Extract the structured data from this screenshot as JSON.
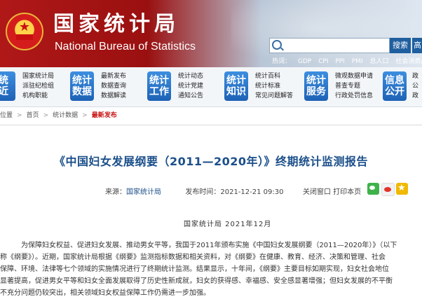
{
  "header": {
    "brand_cn": "国家统计局",
    "brand_en": "National Bureau of Statistics",
    "search": {
      "placeholder": "",
      "button_label": "搜索",
      "extra_label": "高"
    },
    "hot_links": [
      "热词：",
      "GDP",
      "CPI",
      "PPI",
      "PMI",
      "总人口",
      "社会消费品零售"
    ]
  },
  "nav": [
    {
      "tile": [
        "统",
        "近"
      ],
      "links": [
        "国家统计局",
        "派驻纪检组",
        "机构职能"
      ]
    },
    {
      "tile": [
        "统计",
        "数据"
      ],
      "links": [
        "最新发布",
        "数据查询",
        "数据解读"
      ]
    },
    {
      "tile": [
        "统计",
        "工作"
      ],
      "links": [
        "统计动态",
        "统计党建",
        "通知公告"
      ]
    },
    {
      "tile": [
        "统计",
        "知识"
      ],
      "links": [
        "统计百科",
        "统计标准",
        "常见问题解答"
      ]
    },
    {
      "tile": [
        "统计",
        "服务"
      ],
      "links": [
        "微观数据申请",
        "普查专题",
        "行政处罚信息"
      ]
    },
    {
      "tile": [
        "信息",
        "公开"
      ],
      "links": [
        "政",
        "公",
        "政"
      ]
    }
  ],
  "breadcrumb": {
    "items": [
      "位置",
      "首页",
      "统计数据"
    ],
    "current": "最新发布"
  },
  "article": {
    "title": "《中国妇女发展纲要（2011—2020年）》终期统计监测报告",
    "source_label": "来源：",
    "source": "国家统计局",
    "published_label": "发布时间：",
    "published": "2021-12-21  09:30",
    "tools": "关闭窗口  打印本页",
    "dateline": "国家统计局    2021年12月",
    "paragraph_lines": [
      "为保障妇女权益、促进妇女发展、推动男女平等，我国于2011年颁布实施《中国妇女发展纲要（2011—2020年）》（以下",
      "称《纲要》）。近期，国家统计局根据《纲要》监测指标数据和相关资料，对《纲要》在健康、教育、经济、决策和管理、社会",
      "保障、环境、法律等七个领域的实施情况进行了终期统计监测。结果显示，十年间，《纲要》主要目标如期实现，妇女社会地位",
      "显著提高，促进男女平等和妇女全面发展取得了历史性新成就，妇女的获得感、幸福感、安全感显著增强；但妇女发展的不平衡",
      "不充分问题仍较突出，相关领域妇女权益保障工作仍需进一步加强。"
    ]
  },
  "colors": {
    "header_red": "#b01818",
    "title_blue": "#1b4f8a",
    "nav_tile_blue": "#2a74c9",
    "current_crumb_red": "#c81010"
  }
}
